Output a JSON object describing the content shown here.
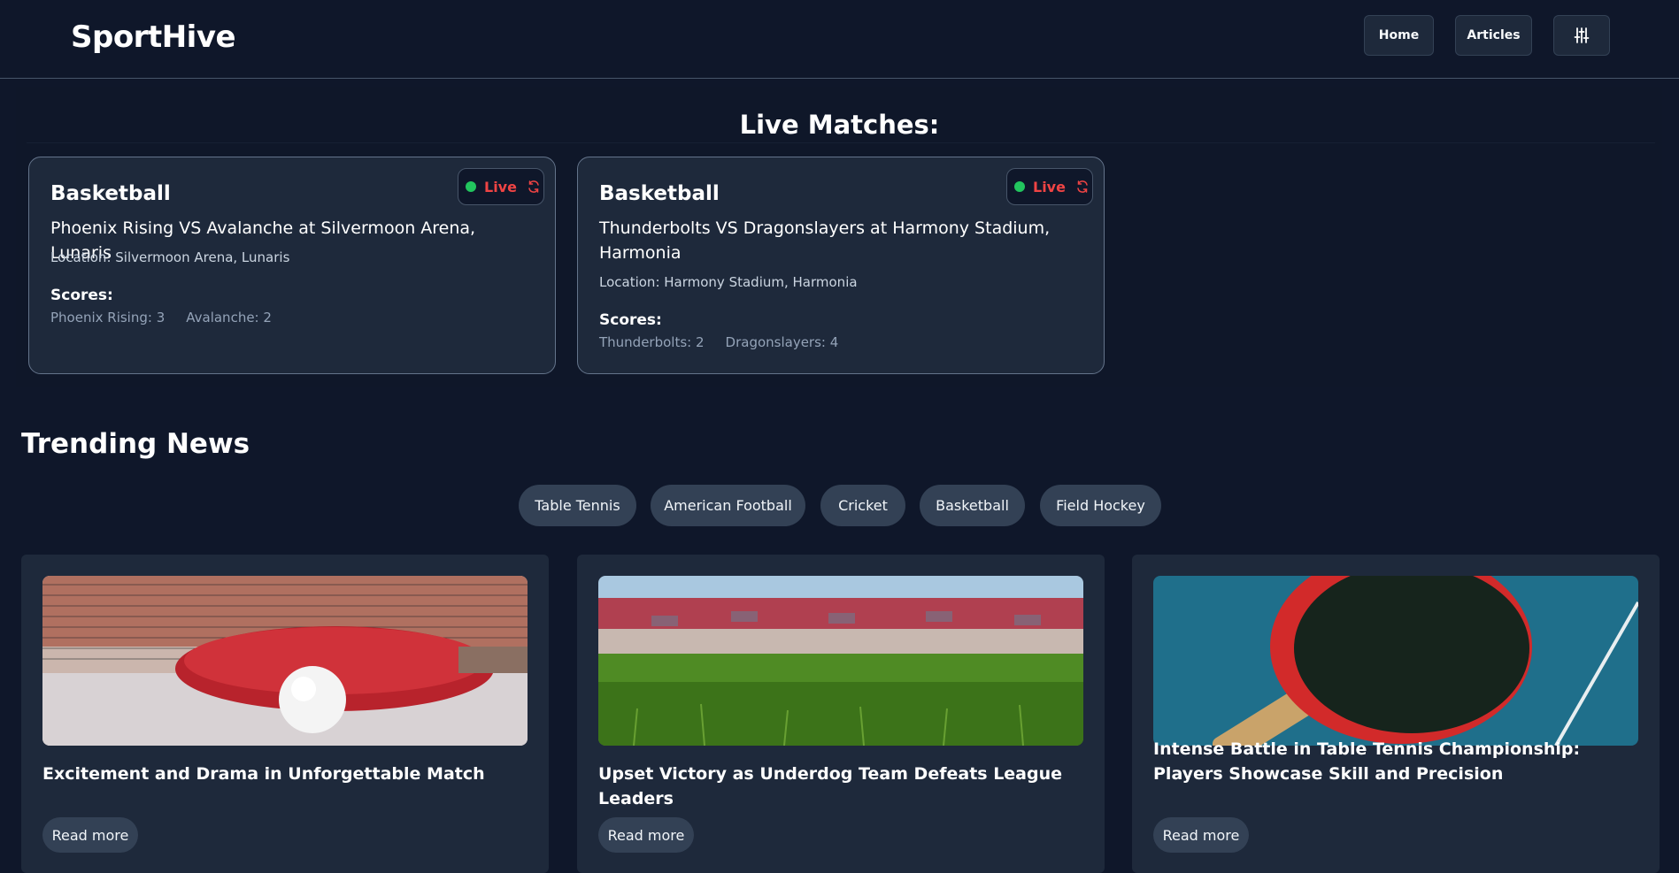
{
  "header": {
    "brand": "SportHive",
    "nav": {
      "home": "Home",
      "articles": "Articles"
    },
    "settings_icon": "sliders-icon"
  },
  "live": {
    "title": "Live Matches:",
    "badge_label": "Live",
    "matches": [
      {
        "sport": "Basketball",
        "title": "Phoenix Rising VS Avalanche at Silvermoon Arena, Lunaris",
        "location": "Location: Silvermoon Arena, Lunaris",
        "scores_label": "Scores:",
        "score_a": "Phoenix Rising: 3",
        "score_b": "Avalanche: 2"
      },
      {
        "sport": "Basketball",
        "title": "Thunderbolts VS Dragonslayers at Harmony Stadium, Harmonia",
        "location": "Location: Harmony Stadium, Harmonia",
        "scores_label": "Scores:",
        "score_a": "Thunderbolts: 2",
        "score_b": "Dragonslayers: 4"
      }
    ]
  },
  "trending": {
    "title": "Trending News",
    "filters": [
      "Table Tennis",
      "American Football",
      "Cricket",
      "Basketball",
      "Field Hockey"
    ],
    "articles": [
      {
        "title": "Excitement and Drama in Unforgettable Match",
        "cta": "Read more"
      },
      {
        "title": "Upset Victory as Underdog Team Defeats League Leaders",
        "cta": "Read more"
      },
      {
        "title": "Intense Battle in Table Tennis Championship: Players Showcase Skill and Precision",
        "cta": "Read more"
      }
    ]
  },
  "colors": {
    "background": "#0f172a",
    "card": "#1e293b",
    "pill": "#334155",
    "live_dot": "#22c55e",
    "live_text": "#ef4444"
  }
}
